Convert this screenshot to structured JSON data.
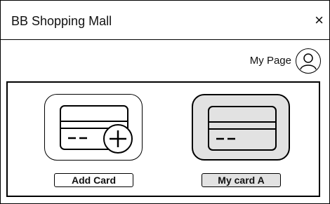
{
  "window": {
    "title": "BB Shopping Mall",
    "close_glyph": "×"
  },
  "header": {
    "my_page_label": "My Page",
    "avatar_icon": "user-circle-icon"
  },
  "cards": [
    {
      "label": "Add Card",
      "icon": "credit-card-add-icon",
      "selected": false
    },
    {
      "label": "My card A",
      "icon": "credit-card-icon",
      "selected": true
    }
  ],
  "colors": {
    "border": "#000000",
    "selected_fill": "#e2e2e2",
    "background": "#ffffff"
  }
}
